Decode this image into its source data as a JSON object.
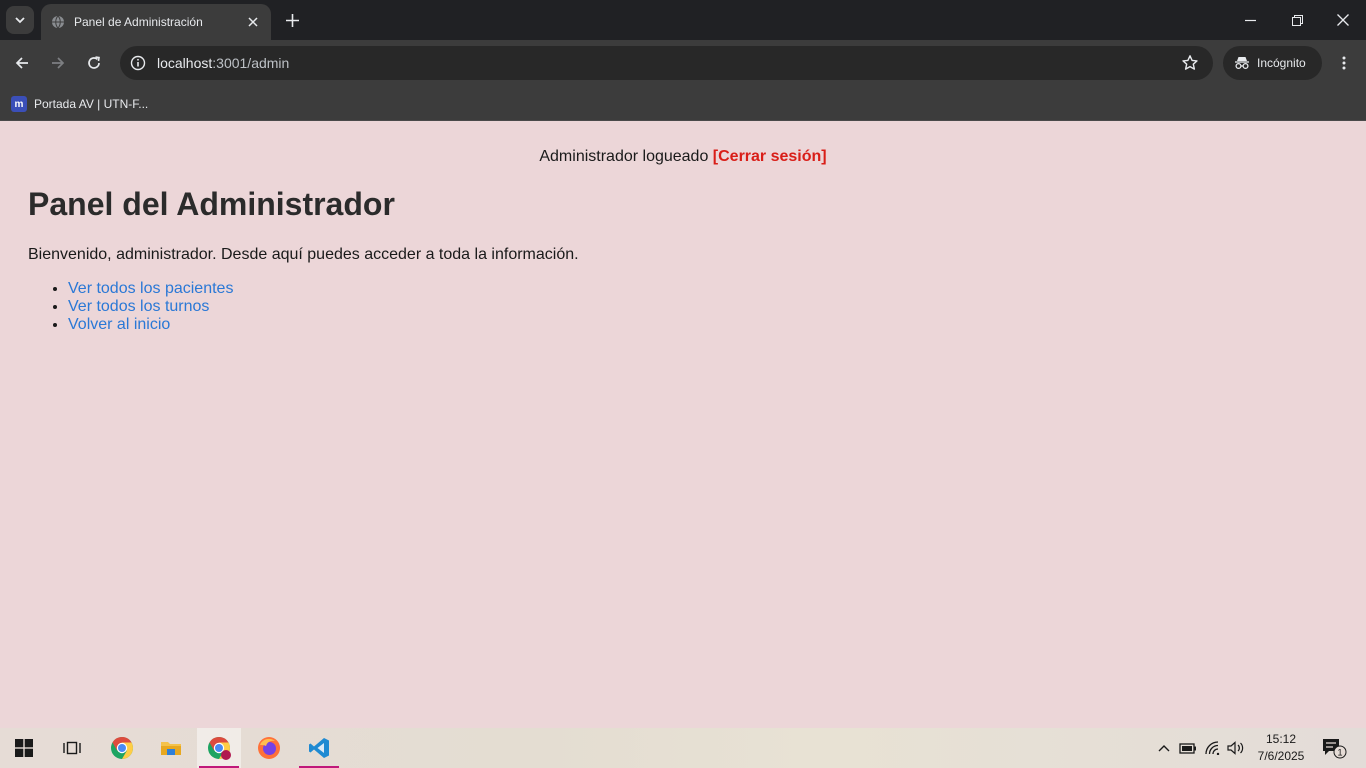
{
  "browser": {
    "tab_title": "Panel de Administración",
    "url_host": "localhost",
    "url_path": ":3001/admin",
    "incognito_label": "Incógnito",
    "bookmark_label": "Portada AV | UTN-F...",
    "bookmark_icon_text": "m"
  },
  "page": {
    "session_text": "Administrador logueado ",
    "logout_label": "[Cerrar sesión]",
    "title": "Panel del Administrador",
    "welcome": "Bienvenido, administrador. Desde aquí puedes acceder a toda la información.",
    "links": [
      {
        "label": "Ver todos los pacientes"
      },
      {
        "label": "Ver todos los turnos"
      },
      {
        "label": "Volver al inicio"
      }
    ]
  },
  "taskbar": {
    "time": "15:12",
    "date": "7/6/2025",
    "notifications": "1",
    "apps": [
      "start-icon",
      "task-view-icon",
      "chrome-icon",
      "file-explorer-icon",
      "chrome-profile-icon",
      "firefox-icon",
      "vscode-icon"
    ]
  },
  "colors": {
    "page_bg": "#ecd6d8",
    "link": "#2a78d6",
    "logout": "#d91e18",
    "chrome_dark": "#202124",
    "chrome_toolbar": "#3c3c3c"
  }
}
